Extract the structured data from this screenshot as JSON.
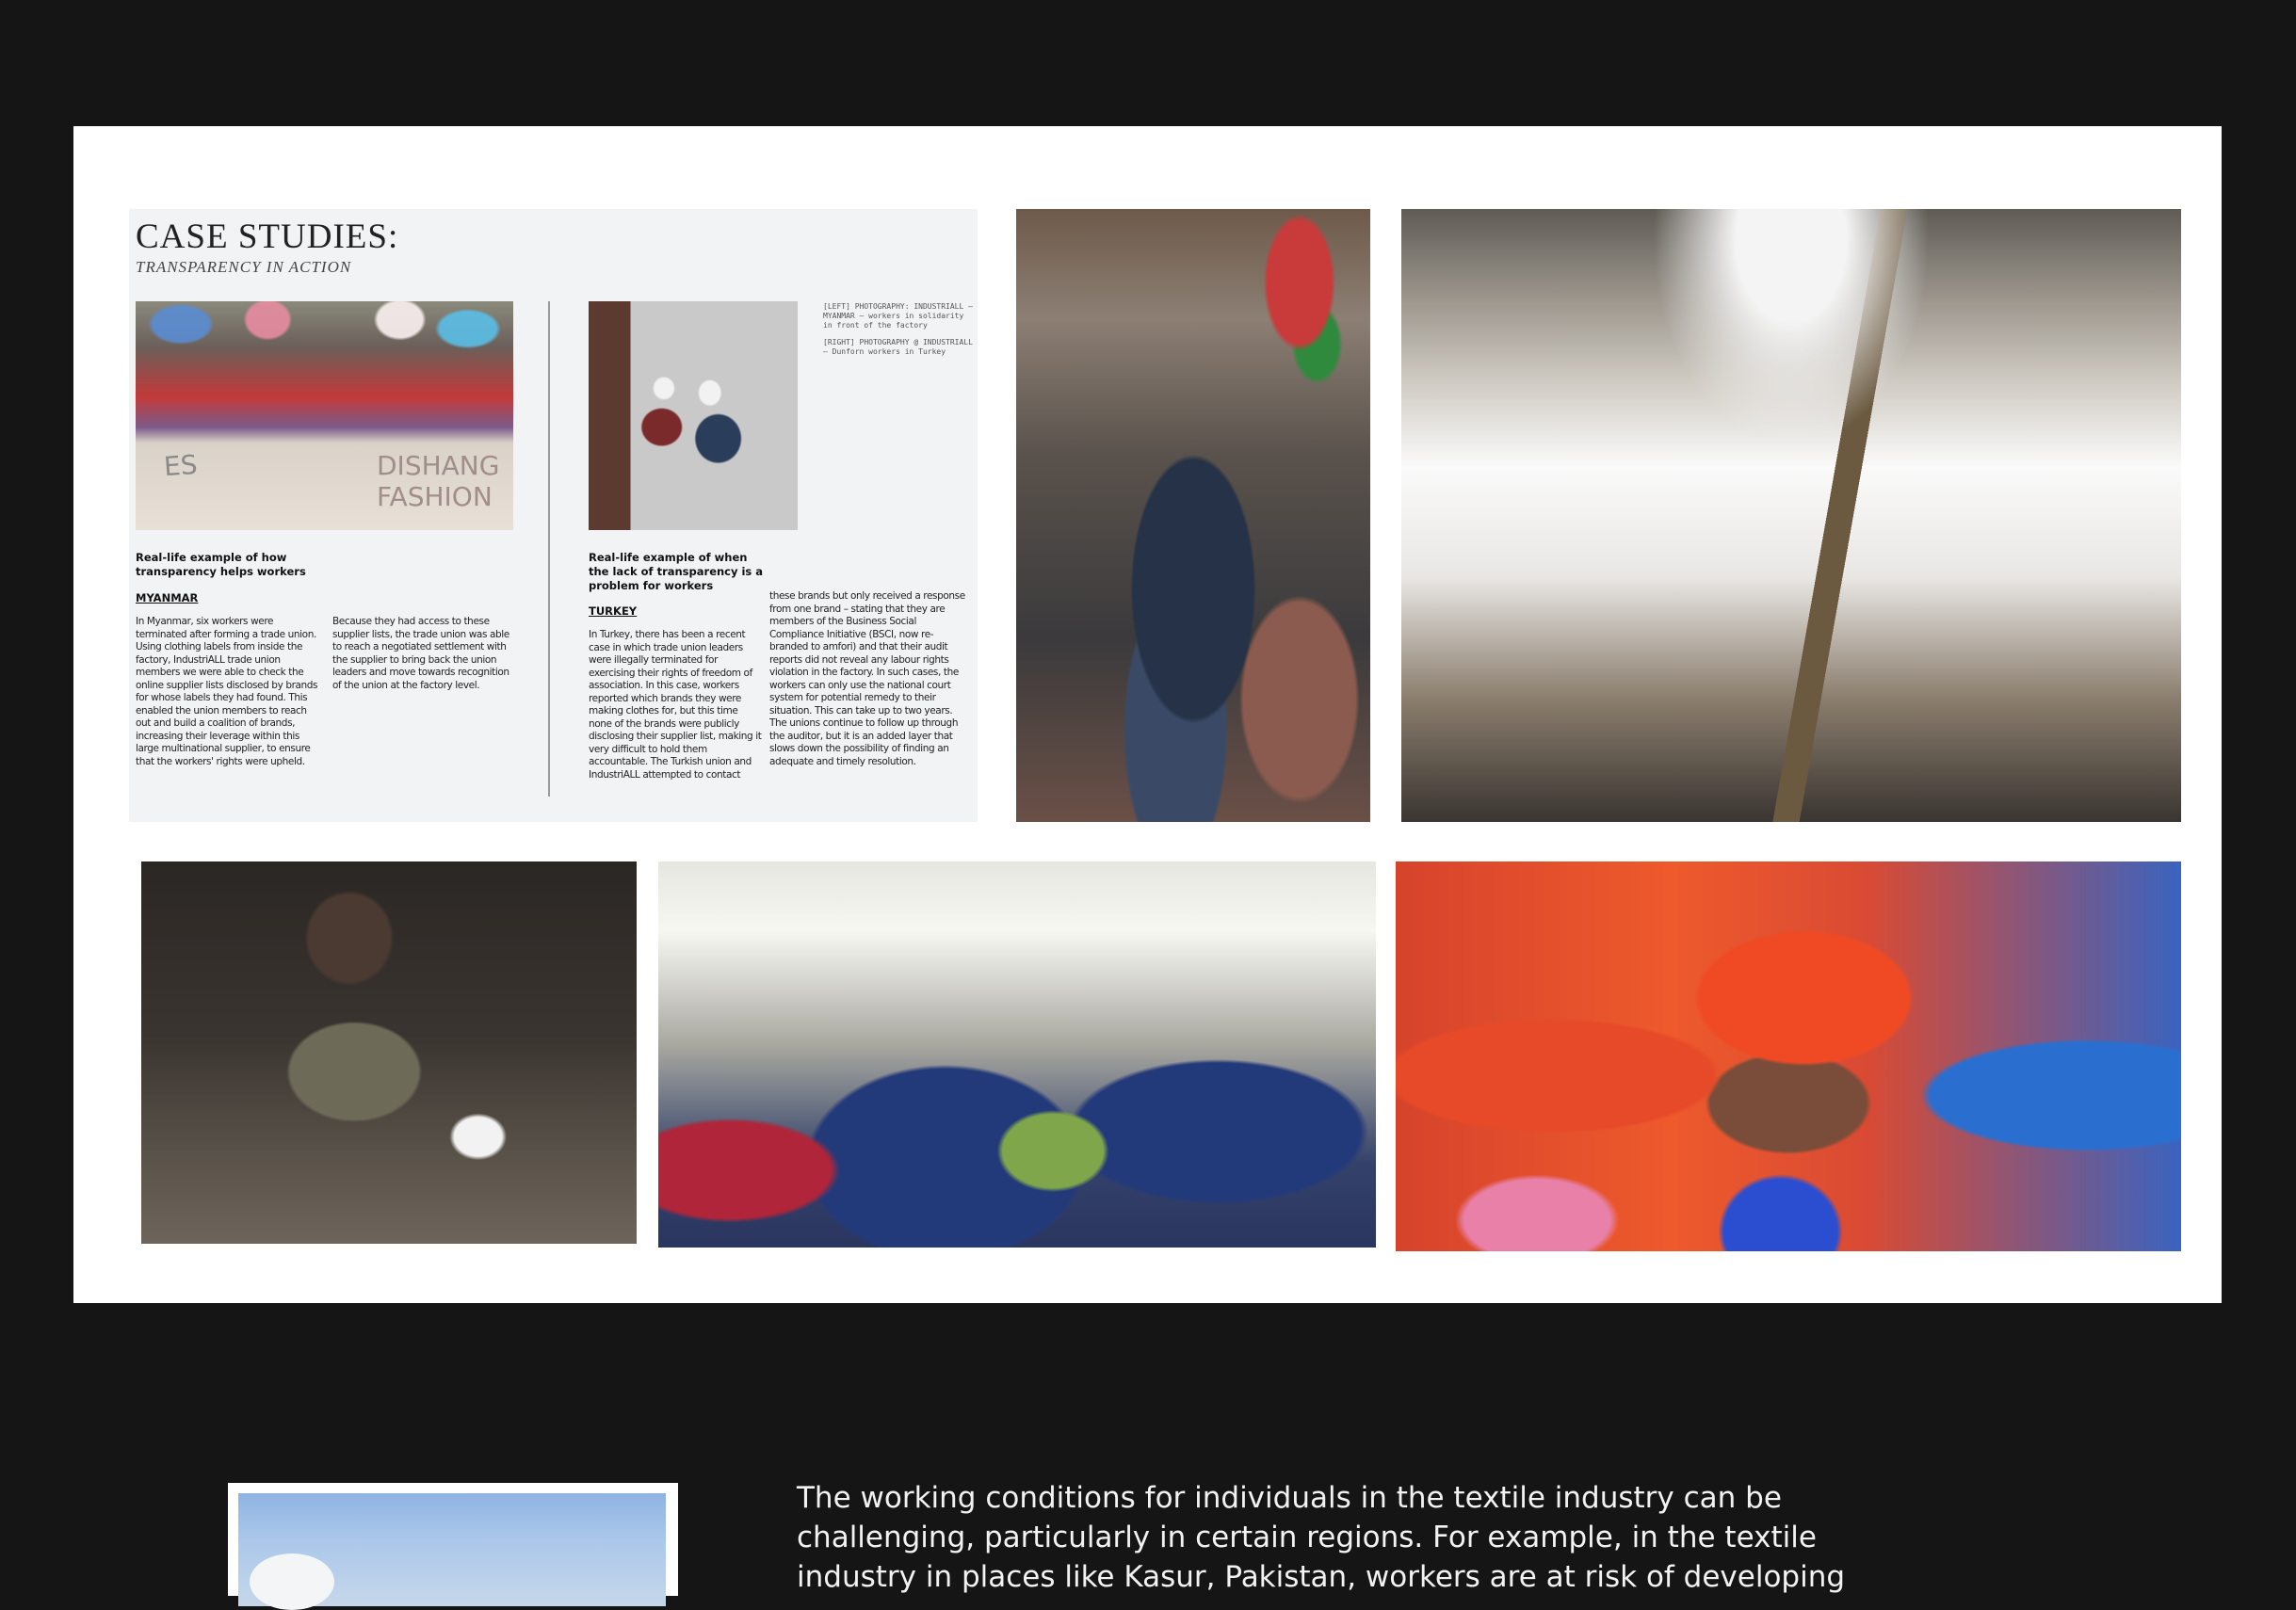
{
  "case_study": {
    "title": "CASE STUDIES:",
    "subtitle": "TRANSPARENCY IN ACTION",
    "sign_left_1": "ES",
    "sign_left_2": "DISHANG FASHION",
    "credits_left": "[LEFT] PHOTOGRAPHY: INDUSTRIALL – MYANMAR – workers in solidarity in front of the factory",
    "credits_right": "[RIGHT] PHOTOGRAPHY @ INDUSTRIALL – Dunforn workers in Turkey",
    "col1": {
      "heading": "Real-life example of how transparency helps workers",
      "tag": "MYANMAR",
      "body_a": "In Myanmar, six workers were terminated after forming a trade union. Using clothing labels from inside the factory, IndustriALL trade union members we were able to check the online supplier lists disclosed by brands for whose labels they had found. This enabled the union members to reach out and build a coalition of brands, increasing their leverage within this large multinational supplier, to ensure that the workers' rights were upheld.",
      "body_b": "Because they had access to these supplier lists, the trade union was able to reach a negotiated settlement with the supplier to bring back the union leaders and move towards recognition of the union at the factory level."
    },
    "col2": {
      "heading": "Real-life example of when the lack of transparency is a problem for workers",
      "tag": "TURKEY",
      "body_a": "In Turkey, there has been a recent case in which trade union leaders were illegally terminated for exercising their rights of freedom of association. In this case, workers reported which brands they were making clothes for, but this time none of the brands were publicly disclosing their supplier list, making it very difficult to hold them accountable. The Turkish union and IndustriALL attempted to contact",
      "body_b": "these brands but only received a response from one brand – stating that they are members of the Business Social Compliance Initiative (BSCI, now re-branded to amfori) and that their audit reports did not reveal any labour rights violation in the factory. In such cases, the workers can only use the national court system for potential remedy to their situation. This can take up to two years. The unions continue to follow up through the auditor, but it is an added layer that slows down the possibility of finding an adequate and timely resolution."
    }
  },
  "body_text": "The working conditions for individuals in the textile industry can be challenging, particularly in certain regions. For example, in the textile industry in places like Kasur, Pakistan, workers are at risk of developing"
}
